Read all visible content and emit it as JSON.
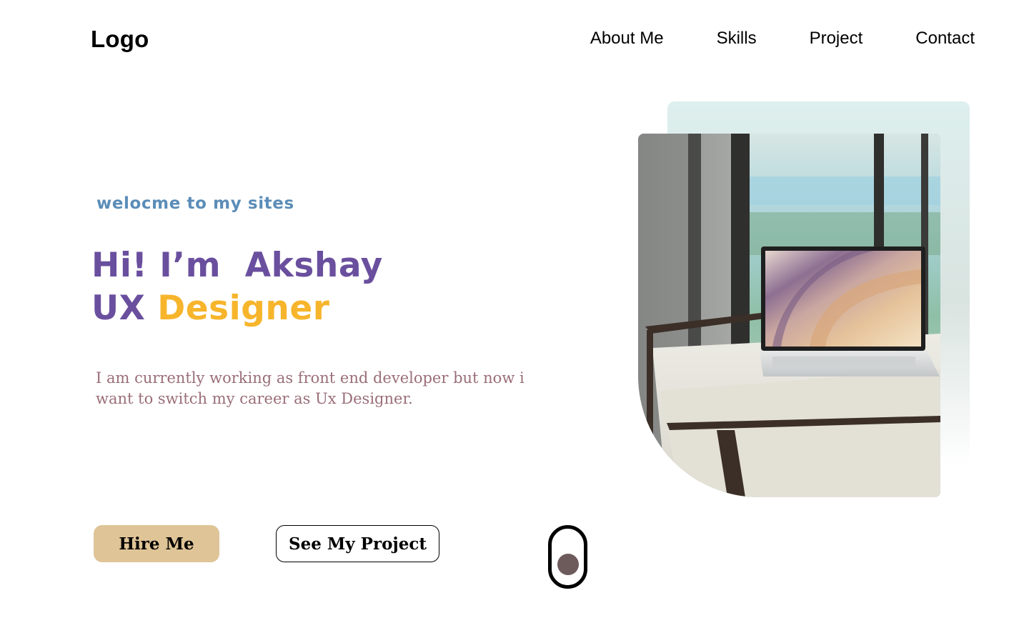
{
  "header": {
    "logo": "Logo",
    "nav": [
      "About Me",
      "Skills",
      "Project",
      "Contact"
    ]
  },
  "hero": {
    "welcome": "welocme to my sites",
    "greeting": "Hi! I’m  Akshay",
    "role_prefix": "UX",
    "role_accent": "Designer",
    "description_line1": "I am currently working as front end developer but now i",
    "description_line2": "want to switch my career as Ux Designer."
  },
  "buttons": {
    "hire": "Hire Me",
    "project": "See My Project"
  },
  "colors": {
    "welcome": "#5b8db8",
    "headline": "#6a4f9e",
    "accent": "#f7b52c",
    "description": "#9a6e78",
    "hire_button": "#dfc497",
    "scroll_dot": "#6d5a5a"
  },
  "icons": {
    "scroll": "mouse-scroll-icon"
  },
  "image": {
    "subject": "laptop-on-bench-photo"
  }
}
